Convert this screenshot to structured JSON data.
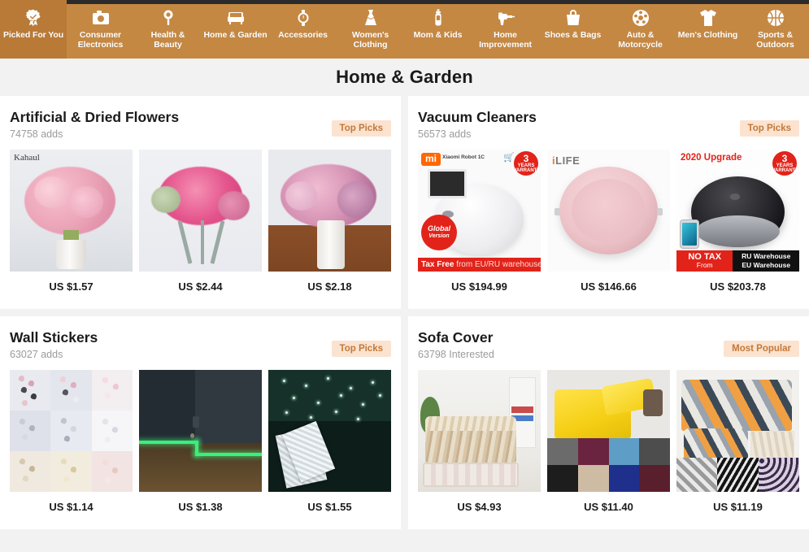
{
  "nav": {
    "items": [
      {
        "label": "Picked For You",
        "icon": "rosette-badge-icon",
        "active": true
      },
      {
        "label": "Consumer Electronics",
        "icon": "camera-icon",
        "active": false
      },
      {
        "label": "Health & Beauty",
        "icon": "mirror-icon",
        "active": false
      },
      {
        "label": "Home & Garden",
        "icon": "sofa-icon",
        "active": false
      },
      {
        "label": "Accessories",
        "icon": "watch-icon",
        "active": false
      },
      {
        "label": "Women's Clothing",
        "icon": "dress-icon",
        "active": false
      },
      {
        "label": "Mom & Kids",
        "icon": "baby-bottle-icon",
        "active": false
      },
      {
        "label": "Home Improvement",
        "icon": "drill-icon",
        "active": false
      },
      {
        "label": "Shoes & Bags",
        "icon": "handbag-icon",
        "active": false
      },
      {
        "label": "Auto & Motorcycle",
        "icon": "wheel-icon",
        "active": false
      },
      {
        "label": "Men's Clothing",
        "icon": "tshirt-icon",
        "active": false
      },
      {
        "label": "Sports & Outdoors",
        "icon": "basketball-icon",
        "active": false
      }
    ],
    "bar_color": "#c58843",
    "active_color": "#b97a37"
  },
  "header": {
    "title": "Home & Garden"
  },
  "sections": [
    {
      "title": "Artificial & Dried Flowers",
      "subtitle": "74758 adds",
      "badge": "Top Picks",
      "products": [
        {
          "price": "US $1.57",
          "watermark": "Kahaul",
          "alt": "pink peony bouquet in white vase"
        },
        {
          "price": "US $2.44",
          "watermark": "",
          "alt": "pink rose bouquet on metal stand"
        },
        {
          "price": "US $2.18",
          "watermark": "",
          "alt": "mauve peony bouquet in white ceramic vase"
        }
      ]
    },
    {
      "title": "Vacuum Cleaners",
      "subtitle": "56573 adds",
      "badge": "Top Picks",
      "products": [
        {
          "price": "US $194.99",
          "alt": "white xiaomi robot vacuum",
          "overlays": {
            "brand": "mi",
            "model": "Xiaomi Robot 1C",
            "circle_badge": {
              "big": "3",
              "small": "YEARS WARRANTY"
            },
            "round_badge": {
              "line1": "Global",
              "line2": "Version"
            },
            "banner": {
              "strong": "Tax Free",
              "rest": "from EU/RU warehouse"
            }
          }
        },
        {
          "price": "US $146.66",
          "alt": "pink ILIFE robot vacuum",
          "overlays": {
            "logo_i": "i",
            "logo_rest": "LIFE"
          }
        },
        {
          "price": "US $203.78",
          "alt": "black robot vacuum with phone app",
          "overlays": {
            "headline": "2020 Upgrade",
            "circle_badge": {
              "big": "3",
              "small": "YEARS WARRANTY"
            },
            "notax_strong": "NO TAX",
            "notax_sub": "From",
            "warehouse_1": "RU Warehouse",
            "warehouse_2": "EU Warehouse"
          }
        }
      ]
    },
    {
      "title": "Wall Stickers",
      "subtitle": "63027 adds",
      "badge": "Top Picks",
      "products": [
        {
          "price": "US $1.14",
          "alt": "3D butterfly wall stickers colour grid"
        },
        {
          "price": "US $1.38",
          "alt": "glow in the dark green strip on baseboard"
        },
        {
          "price": "US $1.55",
          "alt": "glowing star stickers on dark ceiling"
        }
      ]
    },
    {
      "title": "Sofa Cover",
      "subtitle": "63798 Interested",
      "badge": "Most Popular",
      "products": [
        {
          "price": "US $4.93",
          "alt": "floral printed sofa cover in living room"
        },
        {
          "price": "US $11.40",
          "alt": "yellow stretch sofa cover with colour swatches"
        },
        {
          "price": "US $11.19",
          "alt": "geometric print sofa cover with pattern options"
        }
      ]
    }
  ],
  "colors": {
    "nav": "#c58843",
    "nav_active": "#b97a37",
    "page_bg": "#f2f2f2",
    "card_bg": "#ffffff",
    "badge_bg": "#fbe3d0",
    "badge_text": "#c2793a",
    "price_text": "#1b1b1b",
    "subtitle_text": "#9b9b9b",
    "promo_red": "#e2231a",
    "mi_orange": "#ff6700"
  }
}
